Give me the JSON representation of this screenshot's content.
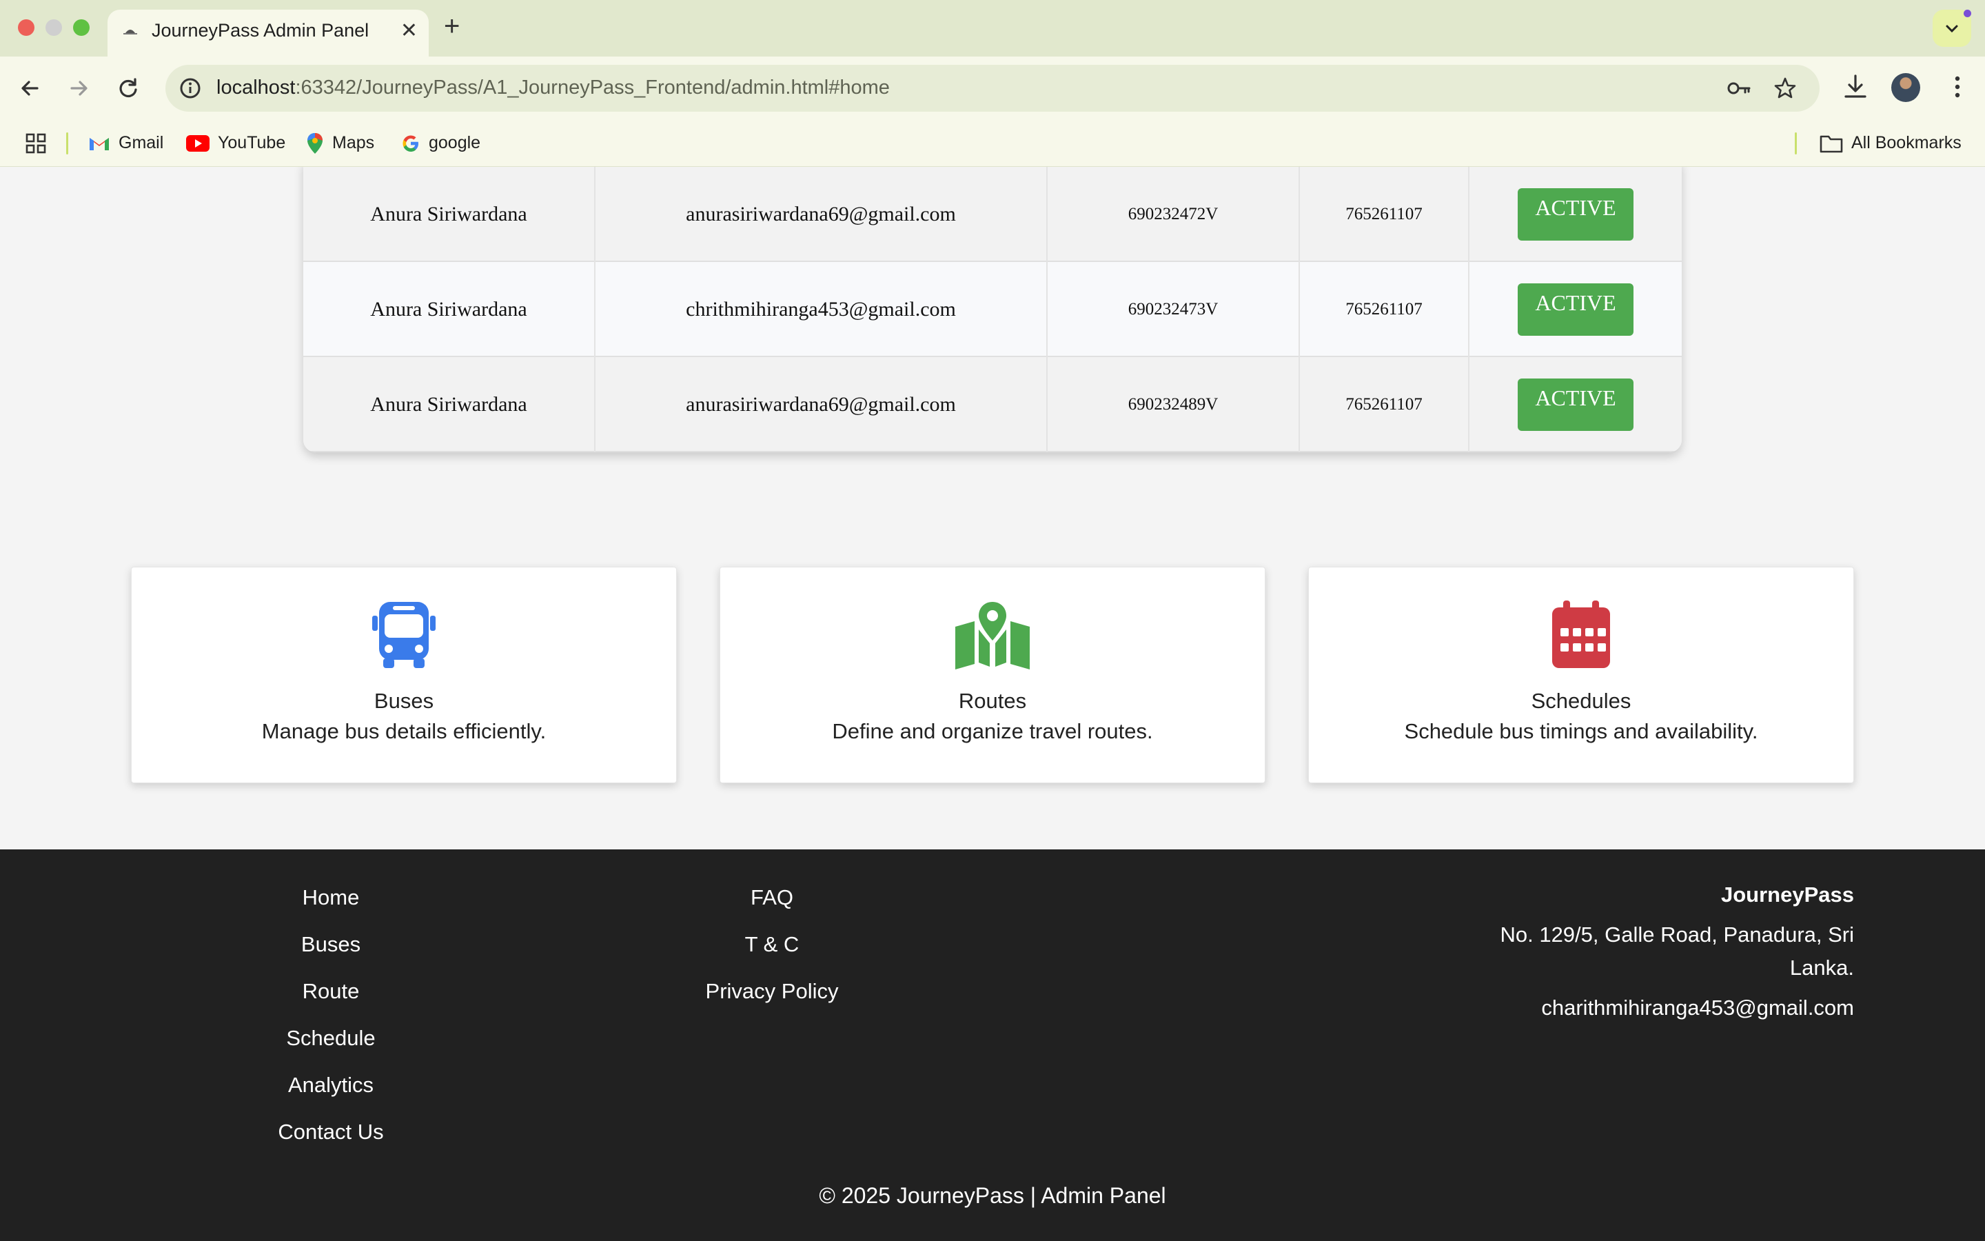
{
  "browser": {
    "tab_title": "JourneyPass Admin Panel",
    "url_host": "localhost",
    "url_path": ":63342/JourneyPass/A1_JourneyPass_Frontend/admin.html#home",
    "bookmarks": [
      "Gmail",
      "YouTube",
      "Maps",
      "google"
    ],
    "all_bookmarks_label": "All Bookmarks"
  },
  "users_table": {
    "rows": [
      {
        "name": "Anura Siriwardana",
        "email": "anurasiriwardana69@gmail.com",
        "nic": "690232472V",
        "phone": "765261107",
        "status": "ACTIVE"
      },
      {
        "name": "Anura Siriwardana",
        "email": "chrithmihiranga453@gmail.com",
        "nic": "690232473V",
        "phone": "765261107",
        "status": "ACTIVE"
      },
      {
        "name": "Anura Siriwardana",
        "email": "anurasiriwardana69@gmail.com",
        "nic": "690232489V",
        "phone": "765261107",
        "status": "ACTIVE"
      }
    ]
  },
  "cards": [
    {
      "title": "Buses",
      "description": "Manage bus details efficiently.",
      "icon": "bus-icon",
      "color": "#3a7bea"
    },
    {
      "title": "Routes",
      "description": "Define and organize travel routes.",
      "icon": "map-icon",
      "color": "#4ea94f"
    },
    {
      "title": "Schedules",
      "description": "Schedule bus timings and availability.",
      "icon": "calendar-icon",
      "color": "#cf3b44"
    }
  ],
  "footer": {
    "nav_links": [
      "Home",
      "Buses",
      "Route",
      "Schedule",
      "Analytics",
      "Contact Us"
    ],
    "info_links": [
      "FAQ",
      "T & C",
      "Privacy Policy"
    ],
    "brand": "JourneyPass",
    "address": "No. 129/5, Galle Road, Panadura, Sri Lanka.",
    "email": "charithmihiranga453@gmail.com",
    "copyright": "© 2025 JourneyPass | Admin Panel"
  },
  "colors": {
    "status_active": "#4ea94f",
    "footer_bg": "#212121"
  }
}
